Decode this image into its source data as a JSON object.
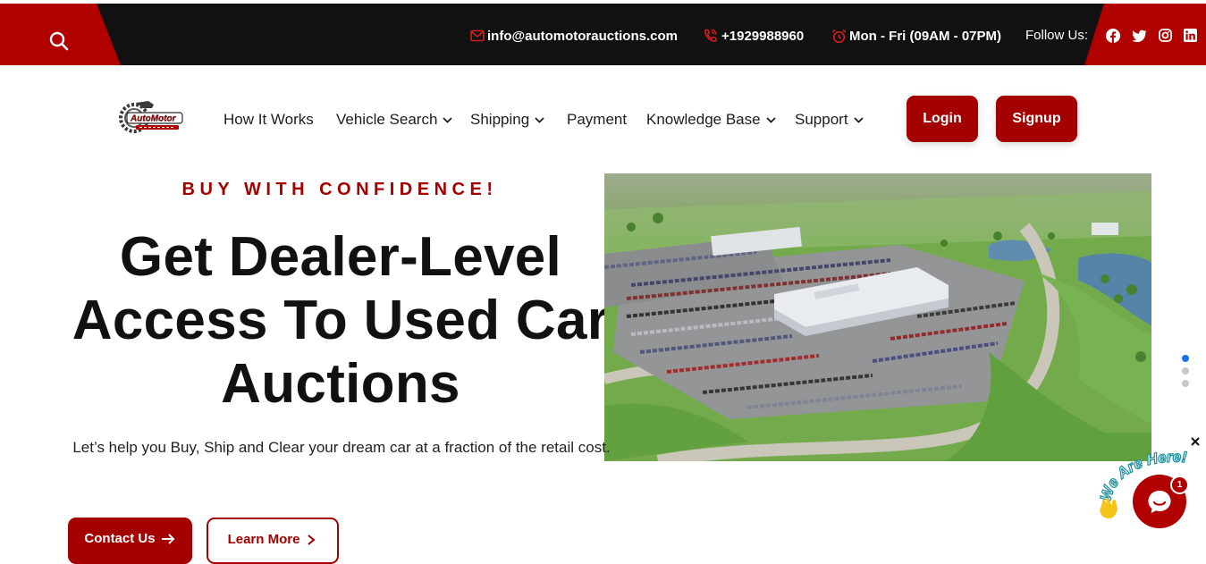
{
  "colors": {
    "brand_red": "#b00000",
    "button_red": "#a50000",
    "topbar_dark": "#111111",
    "dot_active": "#1a73e8"
  },
  "topbar": {
    "search_icon": "search-icon",
    "email": "info@automotorauctions.com",
    "phone": "+1929988960",
    "hours": "Mon - Fri (09AM - 07PM)",
    "follow_label": "Follow Us:",
    "socials": [
      "facebook-icon",
      "twitter-icon",
      "instagram-icon",
      "linkedin-icon"
    ]
  },
  "nav": {
    "logo_text": "AutoMotor",
    "items": [
      {
        "label": "How It Works",
        "dropdown": false
      },
      {
        "label": "Vehicle Search",
        "dropdown": true
      },
      {
        "label": "Shipping",
        "dropdown": true
      },
      {
        "label": "Payment",
        "dropdown": false
      },
      {
        "label": "Knowledge Base",
        "dropdown": true
      },
      {
        "label": "Support",
        "dropdown": true
      }
    ],
    "login_label": "Login",
    "signup_label": "Signup"
  },
  "hero": {
    "kicker": "BUY WITH CONFIDENCE!",
    "headline_line1": "Get Dealer-Level",
    "headline_line2": "Access To Used Car",
    "headline_line3": "Auctions",
    "subtext": "Let’s help you Buy, Ship and Clear your dream car at a fraction of the retail cost.",
    "contact_label": "Contact Us",
    "learn_label": "Learn More",
    "slider_count": 3,
    "slider_active": 1
  },
  "chat": {
    "badge_text": "We Are Here!",
    "unread_count": "1"
  }
}
